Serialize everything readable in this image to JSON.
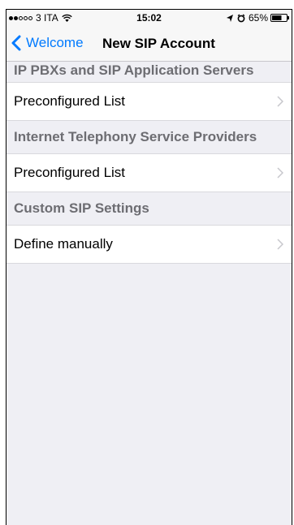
{
  "status_bar": {
    "carrier": "3 ITA",
    "time": "15:02",
    "battery": "65%"
  },
  "nav": {
    "back_label": "Welcome",
    "title": "New SIP Account"
  },
  "sections": [
    {
      "header": "IP PBXs and SIP Application Servers",
      "row": "Preconfigured List"
    },
    {
      "header": "Internet Telephony Service Providers",
      "row": "Preconfigured List"
    },
    {
      "header": "Custom SIP Settings",
      "row": "Define manually"
    }
  ],
  "colors": {
    "accent": "#007aff",
    "background": "#efeff4",
    "header_text": "#6d6d72",
    "chevron": "#c7c7cc"
  },
  "icons": {
    "back": "chevron-left-icon",
    "disclosure": "chevron-right-icon",
    "wifi": "wifi-icon",
    "location": "location-arrow-icon",
    "alarm": "alarm-icon",
    "battery": "battery-icon"
  }
}
